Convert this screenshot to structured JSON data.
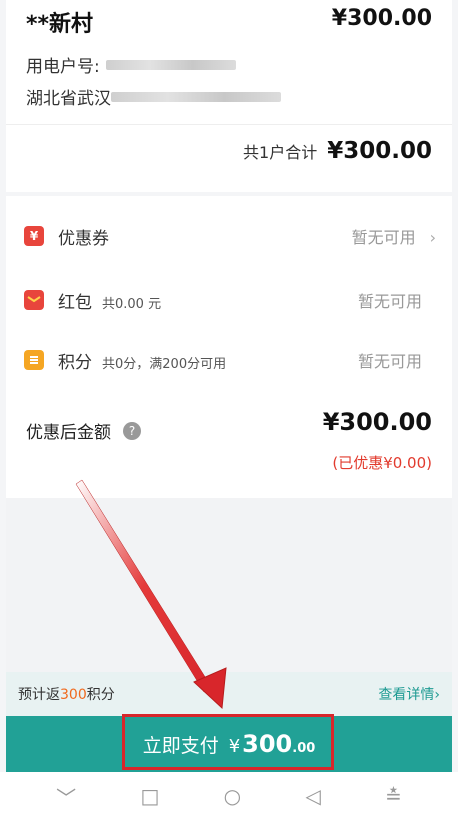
{
  "order": {
    "village": "**新村",
    "amount": "¥300.00",
    "account_label": "用电户号:",
    "address_prefix": "湖北省武汉",
    "total_label": "共1户合计",
    "total_amount": "¥300.00"
  },
  "discounts": {
    "coupon": {
      "label": "优惠券",
      "status": "暂无可用",
      "chevron": "›"
    },
    "red_packet": {
      "label": "红包",
      "sub": "共0.00 元",
      "status": "暂无可用"
    },
    "points": {
      "label": "积分",
      "sub": "共0分，满200分可用",
      "status": "暂无可用"
    },
    "final_label": "优惠后金额",
    "help_icon": "?",
    "final_amount": "¥300.00",
    "saved": "(已优惠¥0.00)"
  },
  "points_bar": {
    "prefix": "预计返",
    "num": "300",
    "suffix": "积分",
    "details": "查看详情›"
  },
  "pay": {
    "label": "立即支付",
    "yen": "¥",
    "int": "300",
    "dec": ".00"
  },
  "nav": {
    "back": "﹀",
    "home": "□",
    "circle": "○",
    "triangle": "◁",
    "menu": "≛"
  },
  "colors": {
    "accent": "#21a196",
    "highlight": "#d8262b",
    "points": "#f06a1e",
    "saved": "#e23b2e"
  }
}
